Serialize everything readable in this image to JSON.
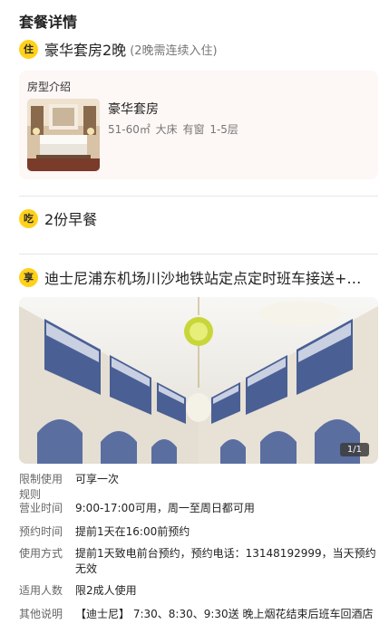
{
  "page_title": "套餐详情",
  "sections": {
    "stay": {
      "badge": "住",
      "title": "豪华套房2晚",
      "note": "(2晚需连续入住)",
      "room_card": {
        "label": "房型介绍",
        "name": "豪华套房",
        "specs": "51-60㎡  大床  有窗  1-5层"
      }
    },
    "meal": {
      "badge": "吃",
      "title": "2份早餐"
    },
    "enjoy": {
      "badge": "享",
      "title": "迪士尼浦东机场川沙地铁站定点定时班车接送+室...",
      "photo_pager": "1/1"
    }
  },
  "details": [
    {
      "label": "限制使用规则",
      "value": "可享一次"
    },
    {
      "label": "营业时间",
      "value": "9:00-17:00可用，周一至周日都可用"
    },
    {
      "label": "预约时间",
      "value": "提前1天在16:00前预约"
    },
    {
      "label": "使用方式",
      "value": "提前1天致电前台预约，预约电话：13148192999，当天预约无效"
    },
    {
      "label": "适用人数",
      "value": "限2成人使用"
    },
    {
      "label": "其他说明",
      "value": "【迪士尼】 7:30、8:30、9:30送 晚上烟花结束后班车回酒店"
    }
  ],
  "colors": {
    "badge": "#ffd11a",
    "card_bg": "#fdf7f6",
    "divider": "#e6e6e6"
  }
}
